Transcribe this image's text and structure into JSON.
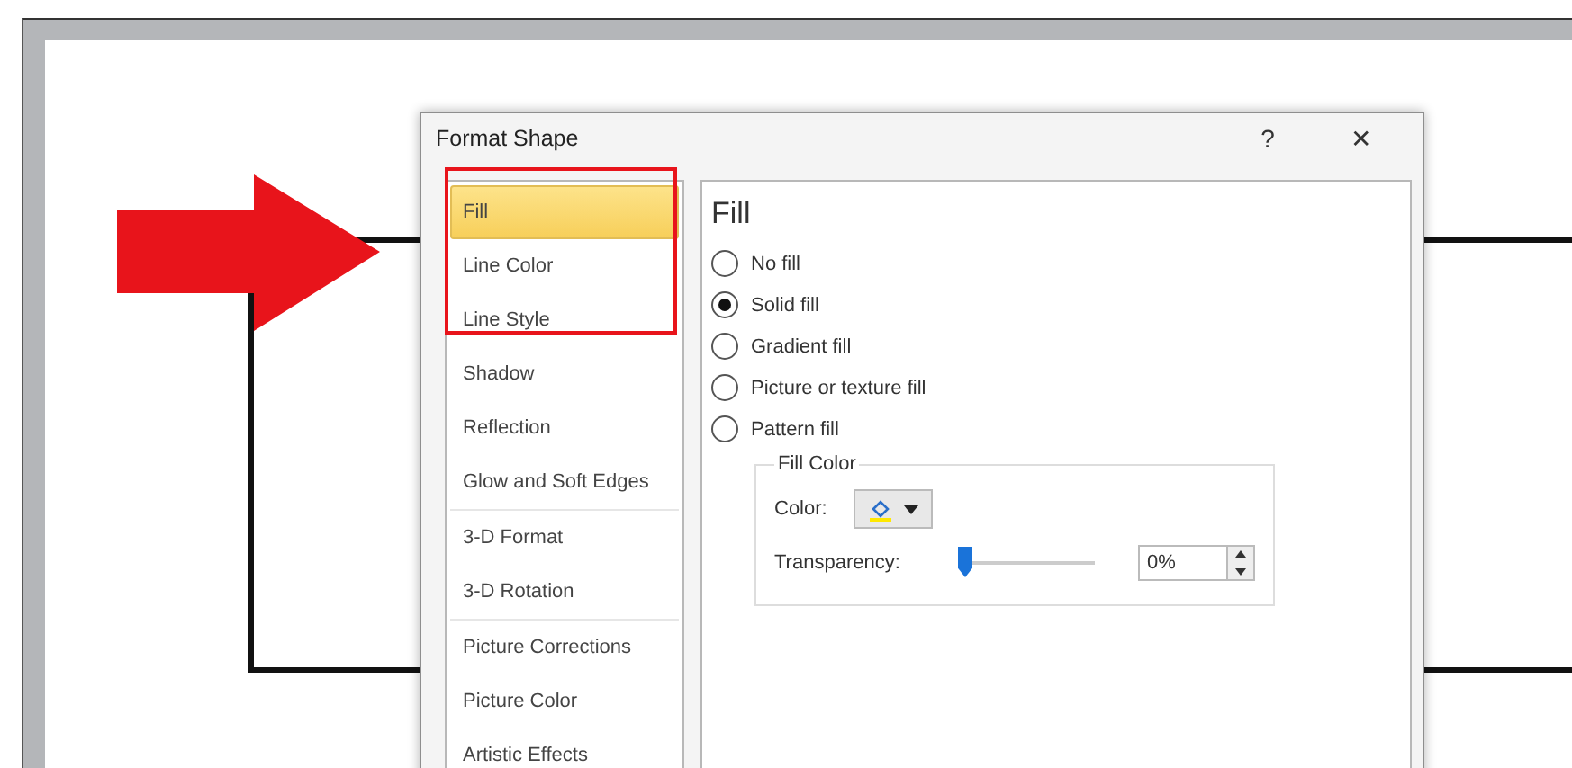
{
  "dialog": {
    "title": "Format Shape",
    "help": "?",
    "close": "✕"
  },
  "nav": {
    "groups": [
      {
        "items": [
          {
            "label": "Fill",
            "selected": true
          },
          {
            "label": "Line Color",
            "selected": false
          },
          {
            "label": "Line Style",
            "selected": false
          },
          {
            "label": "Shadow",
            "selected": false
          },
          {
            "label": "Reflection",
            "selected": false
          },
          {
            "label": "Glow and Soft Edges",
            "selected": false
          }
        ]
      },
      {
        "items": [
          {
            "label": "3-D Format",
            "selected": false
          },
          {
            "label": "3-D Rotation",
            "selected": false
          }
        ]
      },
      {
        "items": [
          {
            "label": "Picture Corrections",
            "selected": false
          },
          {
            "label": "Picture Color",
            "selected": false
          },
          {
            "label": "Artistic Effects",
            "selected": false
          }
        ]
      }
    ]
  },
  "panel": {
    "heading": "Fill",
    "options": [
      {
        "label": "No fill",
        "selected": false
      },
      {
        "label": "Solid fill",
        "selected": true
      },
      {
        "label": "Gradient fill",
        "selected": false
      },
      {
        "label": "Picture or texture fill",
        "selected": false
      },
      {
        "label": "Pattern fill",
        "selected": false
      }
    ],
    "fill_color": {
      "legend": "Fill Color",
      "color_label": "Color:",
      "transparency_label": "Transparency:",
      "transparency": {
        "level": 0
      },
      "transparency_value": "0%"
    }
  }
}
